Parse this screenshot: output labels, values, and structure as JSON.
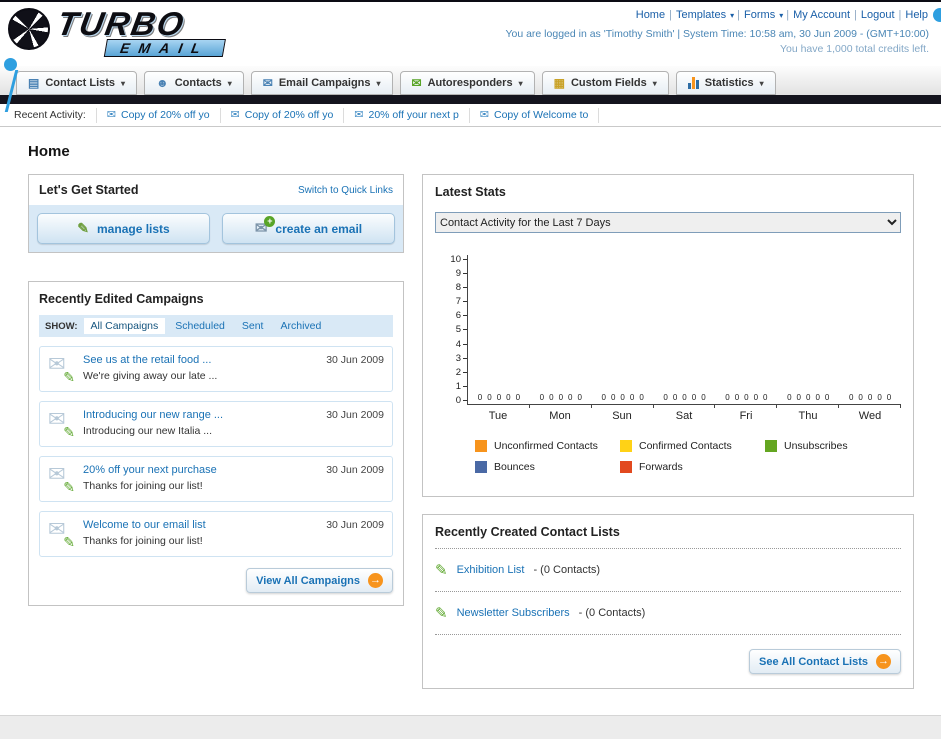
{
  "ui": {
    "separator": "|"
  },
  "icons": {
    "chevron_down": "▾",
    "envelope": "✉",
    "pencil": "✎",
    "list": "▤",
    "person": "☻",
    "grid": "▦",
    "arrow_right": "→",
    "plus": "+"
  },
  "header": {
    "logo_line1": "TURBO",
    "logo_line2": "EMAIL",
    "links": [
      "Home",
      "Templates",
      "Forms",
      "My Account",
      "Logout",
      "Help"
    ],
    "login_info": "You are logged in as 'Timothy Smith' | System Time: 10:58 am, 30 Jun 2009 - (GMT+10:00)",
    "credits": "You have 1,000 total credits left."
  },
  "nav": {
    "items": [
      {
        "label": "Contact Lists"
      },
      {
        "label": "Contacts"
      },
      {
        "label": "Email Campaigns"
      },
      {
        "label": "Autoresponders"
      },
      {
        "label": "Custom Fields"
      },
      {
        "label": "Statistics"
      }
    ]
  },
  "recent_activity": {
    "label": "Recent Activity:",
    "items": [
      "Copy of 20% off yo",
      "Copy of 20% off yo",
      "20% off your next p",
      "Copy of Welcome to"
    ]
  },
  "page": {
    "title": "Home"
  },
  "get_started": {
    "title": "Let's Get Started",
    "switch_link": "Switch to Quick Links",
    "manage_lists_label": "manage lists",
    "create_email_label": "create an email"
  },
  "campaigns": {
    "title": "Recently Edited Campaigns",
    "show_label": "SHOW:",
    "tabs": [
      "All Campaigns",
      "Scheduled",
      "Sent",
      "Archived"
    ],
    "active_tab": "All Campaigns",
    "items": [
      {
        "title": "See us at the retail food ...",
        "subtitle": "We're giving away our late ...",
        "date": "30 Jun 2009"
      },
      {
        "title": "Introducing our new range ...",
        "subtitle": "Introducing our new Italia ...",
        "date": "30 Jun 2009"
      },
      {
        "title": "20% off your next purchase",
        "subtitle": "Thanks for joining our list!",
        "date": "30 Jun 2009"
      },
      {
        "title": "Welcome to our email list",
        "subtitle": "Thanks for joining our list!",
        "date": "30 Jun 2009"
      }
    ],
    "view_all_label": "View All Campaigns"
  },
  "stats": {
    "title": "Latest Stats",
    "period": "Contact Activity for the Last 7 Days"
  },
  "chart_data": {
    "type": "bar",
    "title": "Contact Activity for the Last 7 Days",
    "categories": [
      "Tue",
      "Mon",
      "Sun",
      "Sat",
      "Fri",
      "Thu",
      "Wed"
    ],
    "series": [
      {
        "name": "Unconfirmed Contacts",
        "color": "#f7941d",
        "values": [
          0,
          0,
          0,
          0,
          0,
          0,
          0
        ]
      },
      {
        "name": "Confirmed Contacts",
        "color": "#ffd216",
        "values": [
          0,
          0,
          0,
          0,
          0,
          0,
          0
        ]
      },
      {
        "name": "Unsubscribes",
        "color": "#64a621",
        "values": [
          0,
          0,
          0,
          0,
          0,
          0,
          0
        ]
      },
      {
        "name": "Bounces",
        "color": "#4a69a5",
        "values": [
          0,
          0,
          0,
          0,
          0,
          0,
          0
        ]
      },
      {
        "name": "Forwards",
        "color": "#e2491f",
        "values": [
          0,
          0,
          0,
          0,
          0,
          0,
          0
        ]
      }
    ],
    "ylim": [
      0,
      10
    ],
    "yticks": [
      0,
      1,
      2,
      3,
      4,
      5,
      6,
      7,
      8,
      9,
      10
    ],
    "legend_position": "bottom",
    "grid": false
  },
  "contact_lists": {
    "title": "Recently Created Contact Lists",
    "items": [
      {
        "name": "Exhibition List",
        "detail": "- (0 Contacts)"
      },
      {
        "name": "Newsletter Subscribers",
        "detail": "- (0 Contacts)"
      }
    ],
    "see_all_label": "See All Contact Lists"
  }
}
